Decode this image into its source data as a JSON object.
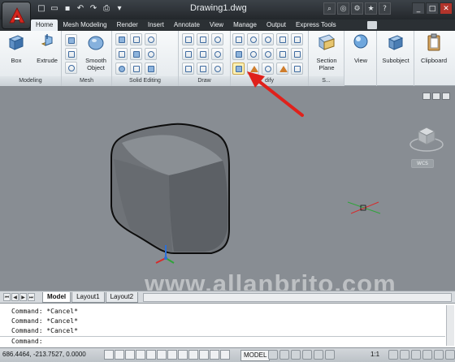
{
  "window": {
    "title": "Drawing1.dwg"
  },
  "ribbon_tabs": [
    "Home",
    "Mesh Modeling",
    "Render",
    "Insert",
    "Annotate",
    "View",
    "Manage",
    "Output",
    "Express Tools"
  ],
  "panels": {
    "modeling": {
      "label": "Modeling",
      "box_label": "Box",
      "extrude_label": "Extrude"
    },
    "mesh": {
      "label": "Mesh",
      "smooth_label": "Smooth\nObject"
    },
    "solid_editing": {
      "label": "Solid Editing"
    },
    "draw": {
      "label": "Draw"
    },
    "modify": {
      "label": "dify"
    },
    "section": {
      "label": "S...",
      "section_plane_label": "Section\nPlane"
    },
    "view": {
      "label": "View"
    },
    "subobject": {
      "label": "Subobject"
    },
    "clipboard": {
      "label": "Clipboard"
    }
  },
  "viewport": {
    "wcs_label": "WCS",
    "watermark": "www.allanbrito.com"
  },
  "layout_tabs": [
    "Model",
    "Layout1",
    "Layout2"
  ],
  "command": {
    "history": [
      "Command: *Cancel*",
      "Command: *Cancel*",
      "Command: *Cancel*"
    ],
    "prompt": "Command:"
  },
  "status": {
    "coords": "686.4464, -213.7527, 0.0000",
    "model_label": "MODEL",
    "scale": "1:1"
  },
  "colors": {
    "arrow": "#e0211b",
    "viewport_bg": "#888d93",
    "cube": "#6f7378"
  }
}
